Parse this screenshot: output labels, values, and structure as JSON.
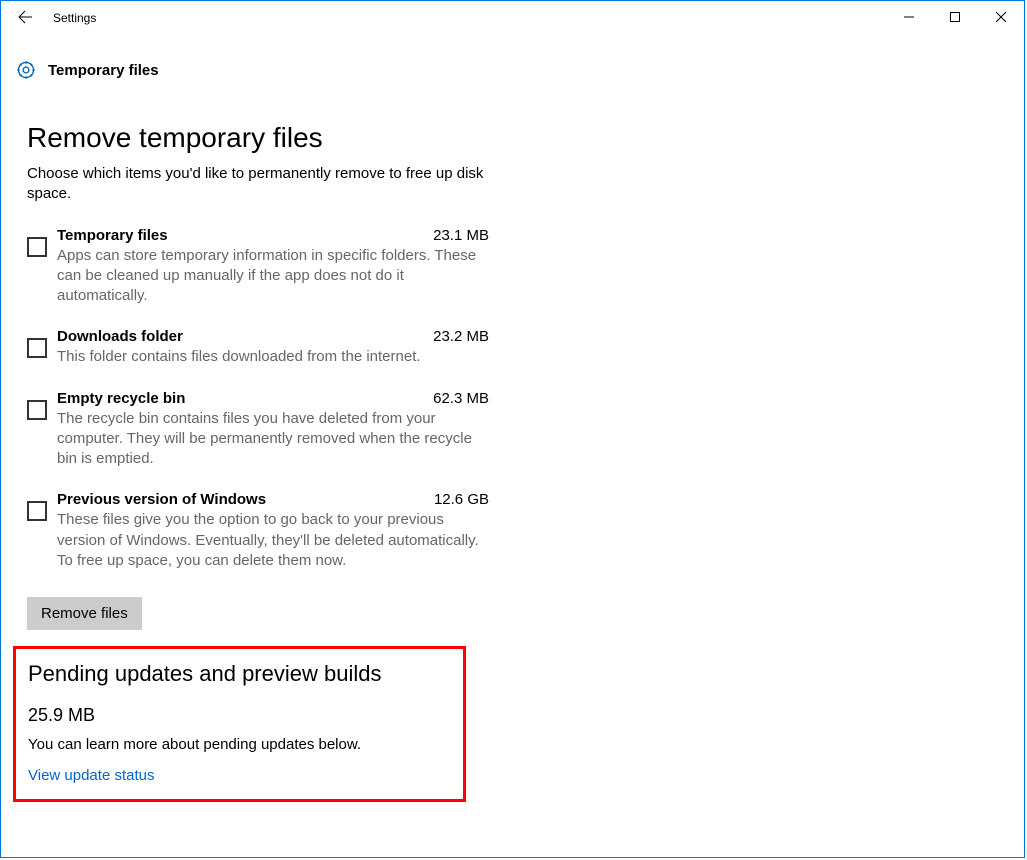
{
  "titlebar": {
    "title": "Settings"
  },
  "page_header": {
    "icon_title": "Temporary files"
  },
  "section": {
    "title": "Remove temporary files",
    "intro": "Choose which items you'd like to permanently remove to free up disk space.",
    "items": [
      {
        "title": "Temporary files",
        "size": "23.1 MB",
        "desc": "Apps can store temporary information in specific folders. These can be cleaned up manually if the app does not do it automatically."
      },
      {
        "title": "Downloads folder",
        "size": "23.2 MB",
        "desc": "This folder contains files downloaded from the internet."
      },
      {
        "title": "Empty recycle bin",
        "size": "62.3 MB",
        "desc": "The recycle bin contains files you have deleted from your computer. They will be permanently removed when the recycle bin is emptied."
      },
      {
        "title": "Previous version of Windows",
        "size": "12.6 GB",
        "desc": "These files give you the option to go back to your previous version of Windows. Eventually, they'll be deleted automatically. To free up space, you can delete them now."
      }
    ],
    "remove_button": "Remove files"
  },
  "pending": {
    "title": "Pending updates and preview builds",
    "size": "25.9 MB",
    "desc": "You can learn more about pending updates below.",
    "link": "View update status"
  }
}
